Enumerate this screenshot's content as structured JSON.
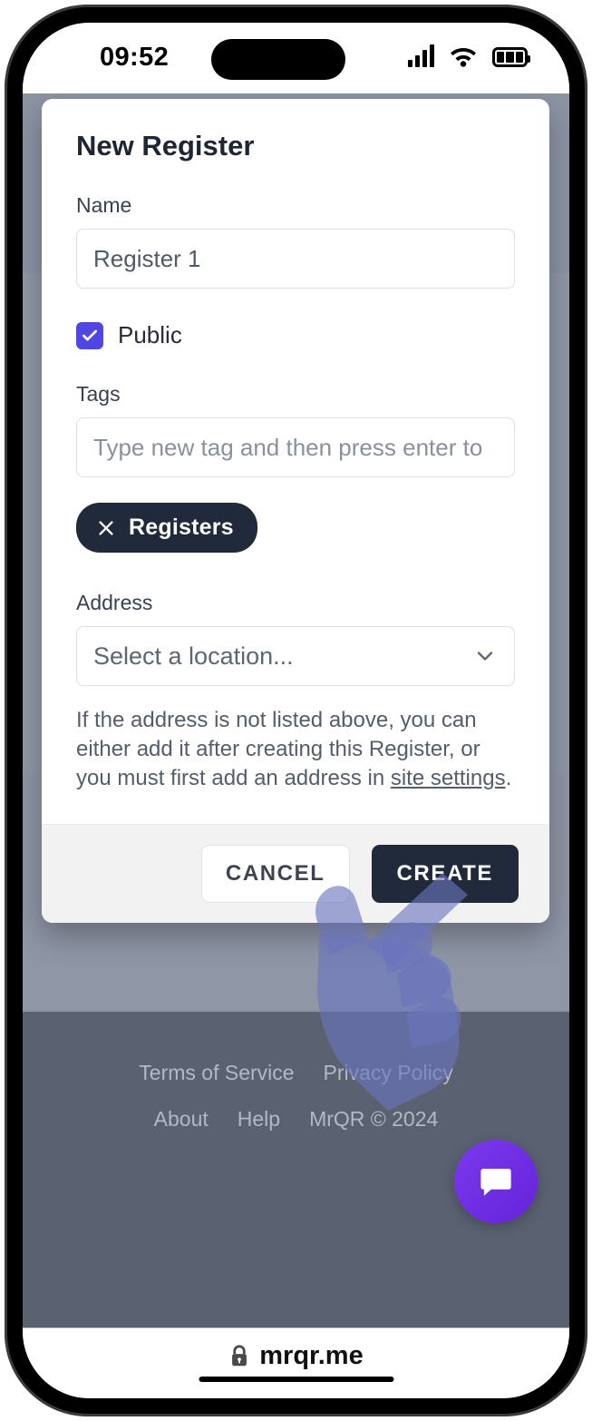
{
  "status_bar": {
    "time": "09:52",
    "icons": [
      "cellular-signal-icon",
      "wifi-icon",
      "battery-icon"
    ]
  },
  "page": {
    "brand": "MrQR",
    "footer": {
      "row1": [
        {
          "label": "Terms of Service",
          "name": "terms-of-service-link"
        },
        {
          "label": "Privacy Policy",
          "name": "privacy-policy-link"
        }
      ],
      "row2": [
        {
          "label": "About",
          "name": "about-link"
        },
        {
          "label": "Help",
          "name": "help-link"
        },
        {
          "label": "MrQR © 2024",
          "name": "copyright-text"
        }
      ]
    },
    "chat_fab": {
      "icon": "chat-bubble-icon",
      "color": "#7c3aed"
    }
  },
  "modal": {
    "title": "New Register",
    "name_field": {
      "label": "Name",
      "value": "Register 1",
      "placeholder": "Register 1"
    },
    "public_checkbox": {
      "label": "Public",
      "checked": true,
      "color": "#5046e4"
    },
    "tags_field": {
      "label": "Tags",
      "value": "",
      "placeholder": "Type new tag and then press enter to",
      "chips": [
        {
          "label": "Registers",
          "remove_icon": "close-icon"
        }
      ]
    },
    "address_field": {
      "label": "Address",
      "selected": "Select a location...",
      "chevron": "chevron-down-icon",
      "help_text_1": "If the address is not listed above, you can either add it after creating this Register, or you must first add an address in ",
      "help_link": "site settings",
      "help_text_2": "."
    },
    "footer": {
      "cancel_label": "CANCEL",
      "create_label": "CREATE"
    }
  },
  "browser": {
    "lock_icon": "lock-icon",
    "url": "mrqr.me"
  },
  "cursor": {
    "type": "pointing-hand-cursor",
    "color": "#6b74bd"
  }
}
